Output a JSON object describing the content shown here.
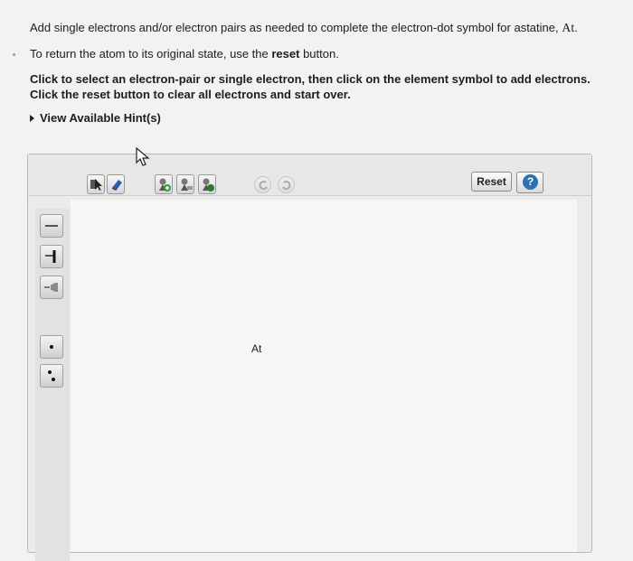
{
  "instructions": {
    "line1_prefix": "Add single electrons and/or electron pairs as needed to complete the electron-dot symbol for astatine, ",
    "element_symbol": "At",
    "line1_suffix": ".",
    "line2_prefix": "To return the atom to its original state, use the ",
    "line2_bold": "reset",
    "line2_suffix": " button.",
    "line3": "Click to select an electron-pair or single electron, then click on the element symbol to add electrons. Click the reset button to clear all electrons and start over.",
    "hint_label": "View Available Hint(s)"
  },
  "toolbar": {
    "reset_label": "Reset",
    "help_label": "?",
    "icons": [
      "select-arrow-icon",
      "eraser-icon",
      "add-charge-icon",
      "remove-charge-icon",
      "zoom-icon",
      "undo-icon",
      "redo-icon"
    ]
  },
  "sidebar": {
    "icons": [
      "single-bond-icon",
      "double-bond-icon",
      "triple-bond-icon",
      "single-electron-icon",
      "electron-pair-icon"
    ]
  },
  "canvas": {
    "atom_symbol": "At"
  },
  "colors": {
    "background": "#f3f2f0",
    "toolbar": "#e7e7e5",
    "help_accent": "#2f6fb3",
    "green_accent": "#3a9b3a"
  }
}
